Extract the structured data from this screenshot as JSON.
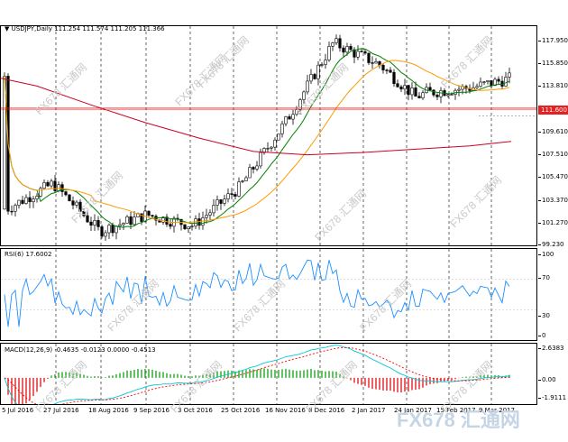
{
  "chart": {
    "title": "USDJPY,Daily",
    "ohlc": "111.254 111.574 111.205 111.366",
    "current_price": "111.600"
  },
  "price_axis": [
    "117.950",
    "115.850",
    "113.810",
    "111.600",
    "109.610",
    "107.510",
    "105.470",
    "103.370",
    "101.270",
    "99.230"
  ],
  "rsi": {
    "label": "RSI(6) 17.6002",
    "levels": [
      "100",
      "70",
      "30",
      "0"
    ]
  },
  "macd": {
    "label": "MACD(12,26,9) -0.4635 -0.0123 0.0000 -0.4513",
    "levels": [
      "2.6383",
      "0.00",
      "-1.9111"
    ]
  },
  "time_axis": [
    "5 Jul 2016",
    "27 Jul 2016",
    "18 Aug 2016",
    "9 Sep 2016",
    "3 Oct 2016",
    "25 Oct 2016",
    "16 Nov 2016",
    "8 Dec 2016",
    "2 Jan 2017",
    "24 Jan 2017",
    "15 Feb 2017",
    "9 Mar 2017"
  ],
  "watermark": "FX678 汇通网",
  "logo": "FX678 汇通网",
  "colors": {
    "ma_short": "#008000",
    "ma_mid": "#ff9900",
    "ma_long": "#cc0022",
    "rsi": "#1e90ff",
    "macd": "#00c8d7",
    "signal": "#ff0000",
    "hist": "#22a822"
  },
  "chart_data": {
    "type": "line",
    "x": [
      "5 Jul 2016",
      "27 Jul 2016",
      "18 Aug 2016",
      "9 Sep 2016",
      "3 Oct 2016",
      "25 Oct 2016",
      "16 Nov 2016",
      "8 Dec 2016",
      "2 Jan 2017",
      "24 Jan 2017",
      "15 Feb 2017",
      "9 Mar 2017"
    ],
    "series": [
      {
        "values": [
          102.5,
          104.8,
          100.5,
          102.0,
          101.0,
          104.5,
          110.5,
          117.5,
          115.5,
          113.0,
          113.5,
          114.5
        ]
      }
    ],
    "ylim": [
      99.23,
      119.0
    ]
  }
}
